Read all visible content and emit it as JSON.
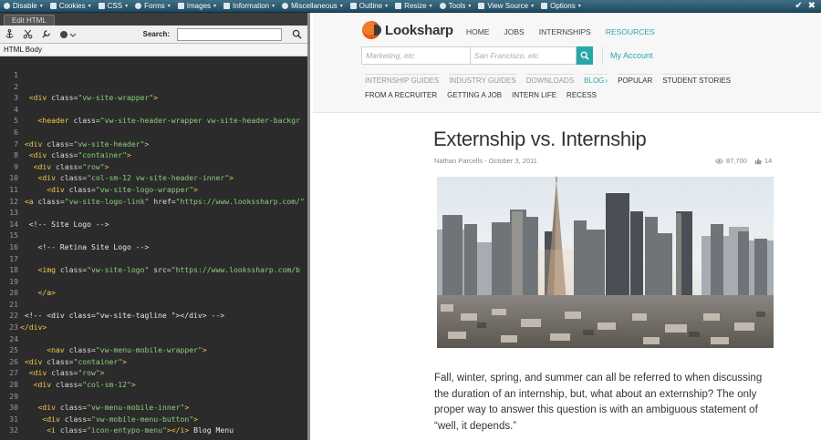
{
  "toolbar": {
    "items": [
      {
        "label": "Disable",
        "icon": "no-icon"
      },
      {
        "label": "Cookies",
        "icon": "cookie-icon"
      },
      {
        "label": "CSS",
        "icon": "css-icon"
      },
      {
        "label": "Forms",
        "icon": "form-icon"
      },
      {
        "label": "Images",
        "icon": "image-icon"
      },
      {
        "label": "Information",
        "icon": "info-icon"
      },
      {
        "label": "Miscellaneous",
        "icon": "misc-icon"
      },
      {
        "label": "Outline",
        "icon": "outline-icon"
      },
      {
        "label": "Resize",
        "icon": "resize-icon"
      },
      {
        "label": "Tools",
        "icon": "tools-icon"
      },
      {
        "label": "View Source",
        "icon": "source-icon"
      },
      {
        "label": "Options",
        "icon": "options-icon"
      }
    ]
  },
  "editor": {
    "tab_label": "Edit HTML",
    "search_label": "Search:",
    "section_label": "HTML Body",
    "lines": [
      {
        "n": "1",
        "indent": "",
        "parts": []
      },
      {
        "n": "2",
        "indent": "",
        "parts": []
      },
      {
        "n": "3",
        "indent": "  ",
        "parts": [
          [
            "tag",
            "<div "
          ],
          [
            "attr",
            "class="
          ],
          [
            "val",
            "\"vw-site-wrapper\""
          ],
          [
            "tag",
            ">"
          ]
        ]
      },
      {
        "n": "4",
        "indent": "",
        "parts": []
      },
      {
        "n": "5",
        "indent": "    ",
        "parts": [
          [
            "tag",
            "<header "
          ],
          [
            "attr",
            "class="
          ],
          [
            "val",
            "\"vw-site-header-wrapper vw-site-header-backgr"
          ]
        ]
      },
      {
        "n": "6",
        "indent": "",
        "parts": []
      },
      {
        "n": "7",
        "indent": " ",
        "parts": [
          [
            "tag",
            "<div "
          ],
          [
            "attr",
            "class="
          ],
          [
            "val",
            "\"vw-site-header\""
          ],
          [
            "tag",
            ">"
          ]
        ]
      },
      {
        "n": "8",
        "indent": "  ",
        "parts": [
          [
            "tag",
            "<div "
          ],
          [
            "attr",
            "class="
          ],
          [
            "val",
            "\"container\""
          ],
          [
            "tag",
            ">"
          ]
        ]
      },
      {
        "n": "9",
        "indent": "   ",
        "parts": [
          [
            "tag",
            "<div "
          ],
          [
            "attr",
            "class="
          ],
          [
            "val",
            "\"row\""
          ],
          [
            "tag",
            ">"
          ]
        ]
      },
      {
        "n": "10",
        "indent": "    ",
        "parts": [
          [
            "tag",
            "<div "
          ],
          [
            "attr",
            "class="
          ],
          [
            "val",
            "\"col-sm-12 vw-site-header-inner\""
          ],
          [
            "tag",
            ">"
          ]
        ]
      },
      {
        "n": "11",
        "indent": "      ",
        "parts": [
          [
            "tag",
            "<div "
          ],
          [
            "attr",
            "class="
          ],
          [
            "val",
            "\"vw-site-logo-wrapper\""
          ],
          [
            "tag",
            ">"
          ]
        ]
      },
      {
        "n": "12",
        "indent": " ",
        "parts": [
          [
            "tag",
            "<a "
          ],
          [
            "attr",
            "class="
          ],
          [
            "val",
            "\"vw-site-logo-link\" "
          ],
          [
            "attr",
            "href="
          ],
          [
            "val",
            "\"https://www.lookssharp.com/\""
          ]
        ]
      },
      {
        "n": "13",
        "indent": "",
        "parts": []
      },
      {
        "n": "14",
        "indent": "  ",
        "parts": [
          [
            "com",
            "<!-- Site Logo -->"
          ]
        ]
      },
      {
        "n": "15",
        "indent": "",
        "parts": []
      },
      {
        "n": "16",
        "indent": "    ",
        "parts": [
          [
            "com",
            "<!-- Retina Site Logo -->"
          ]
        ]
      },
      {
        "n": "17",
        "indent": "",
        "parts": []
      },
      {
        "n": "18",
        "indent": "    ",
        "parts": [
          [
            "tag",
            "<img "
          ],
          [
            "attr",
            "class="
          ],
          [
            "val",
            "\"vw-site-logo\" "
          ],
          [
            "attr",
            "src="
          ],
          [
            "val",
            "\"https://www.lookssharp.com/b"
          ]
        ]
      },
      {
        "n": "19",
        "indent": "",
        "parts": []
      },
      {
        "n": "20",
        "indent": "    ",
        "parts": [
          [
            "tag",
            "</a>"
          ]
        ]
      },
      {
        "n": "21",
        "indent": "",
        "parts": []
      },
      {
        "n": "22",
        "indent": " ",
        "parts": [
          [
            "com",
            "<!-- <div class=\"vw-site-tagline \"></div> -->"
          ]
        ]
      },
      {
        "n": "23",
        "indent": "",
        "parts": [
          [
            "tag",
            "</div>"
          ]
        ]
      },
      {
        "n": "24",
        "indent": "",
        "parts": []
      },
      {
        "n": "25",
        "indent": "      ",
        "parts": [
          [
            "tag",
            "<nav "
          ],
          [
            "attr",
            "class="
          ],
          [
            "val",
            "\"vw-menu-mobile-wrapper\""
          ],
          [
            "tag",
            ">"
          ]
        ]
      },
      {
        "n": "26",
        "indent": " ",
        "parts": [
          [
            "tag",
            "<div "
          ],
          [
            "attr",
            "class="
          ],
          [
            "val",
            "\"container\""
          ],
          [
            "tag",
            ">"
          ]
        ]
      },
      {
        "n": "27",
        "indent": "  ",
        "parts": [
          [
            "tag",
            "<div "
          ],
          [
            "attr",
            "class="
          ],
          [
            "val",
            "\"row\""
          ],
          [
            "tag",
            ">"
          ]
        ]
      },
      {
        "n": "28",
        "indent": "   ",
        "parts": [
          [
            "tag",
            "<div "
          ],
          [
            "attr",
            "class="
          ],
          [
            "val",
            "\"col-sm-12\""
          ],
          [
            "tag",
            ">"
          ]
        ]
      },
      {
        "n": "29",
        "indent": "",
        "parts": []
      },
      {
        "n": "30",
        "indent": "    ",
        "parts": [
          [
            "tag",
            "<div "
          ],
          [
            "attr",
            "class="
          ],
          [
            "val",
            "\"vw-menu-mobile-inner\""
          ],
          [
            "tag",
            ">"
          ]
        ]
      },
      {
        "n": "31",
        "indent": "     ",
        "parts": [
          [
            "tag",
            "<div "
          ],
          [
            "attr",
            "class="
          ],
          [
            "val",
            "\"vw-mobile-menu-button\""
          ],
          [
            "tag",
            ">"
          ]
        ]
      },
      {
        "n": "32",
        "indent": "      ",
        "parts": [
          [
            "tag",
            "<i "
          ],
          [
            "attr",
            "class="
          ],
          [
            "val",
            "\"icon-entypo-menu\""
          ],
          [
            "tag",
            "></i>"
          ],
          [
            "com",
            " Blog Menu"
          ]
        ]
      }
    ]
  },
  "site": {
    "logo_text": "Looksharp",
    "nav": [
      {
        "label": "HOME",
        "active": false
      },
      {
        "label": "JOBS",
        "active": false
      },
      {
        "label": "INTERNSHIPS",
        "active": false
      },
      {
        "label": "RESOURCES",
        "active": true
      }
    ],
    "search_keyword_placeholder": "Marketing, etc",
    "search_location_placeholder": "San Francisco, etc",
    "my_account": "My Account",
    "subnav": [
      {
        "label": "INTERNSHIP GUIDES",
        "style": "muted"
      },
      {
        "label": "INDUSTRY GUIDES",
        "style": "muted"
      },
      {
        "label": "DOWNLOADS",
        "style": "muted"
      },
      {
        "label": "BLOG",
        "style": "blog"
      },
      {
        "label": "POPULAR",
        "style": "dark"
      },
      {
        "label": "STUDENT STORIES",
        "style": "dark"
      },
      {
        "label": "FROM A RECRUITER",
        "style": "dark"
      },
      {
        "label": "GETTING A JOB",
        "style": "dark"
      },
      {
        "label": "INTERN LIFE",
        "style": "dark"
      },
      {
        "label": "RECESS",
        "style": "dark"
      }
    ],
    "colors": {
      "accent": "#2aa6a8",
      "logo_orange": "#e8661c"
    }
  },
  "article": {
    "title": "Externship vs. Internship",
    "meta": "Nathan Parcells - October 3, 2011",
    "views": "87,700",
    "likes": "14",
    "body": "Fall, winter, spring, and summer can all be referred to when discussing the duration of an internship, but, what about an externship? The only proper way to answer this question is with an ambiguous statement of “well, it depends.”"
  }
}
